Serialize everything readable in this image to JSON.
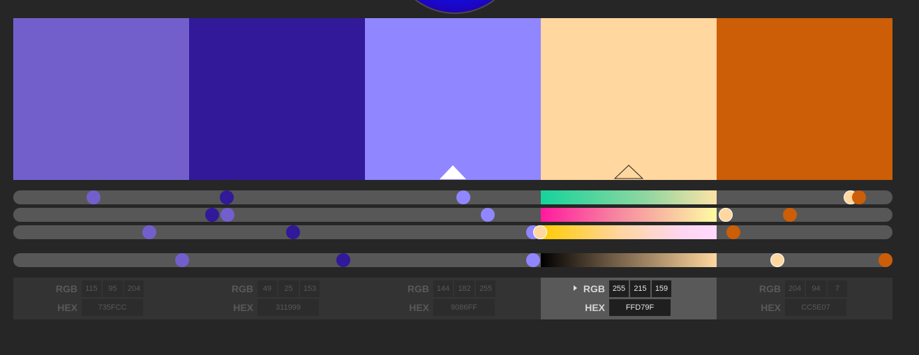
{
  "selected_index": 3,
  "swatches": [
    {
      "color": "#735FCC",
      "rgb": {
        "r": "115",
        "g": "95",
        "b": "204"
      },
      "hex": "735FCC",
      "values": {
        "h": 0.091,
        "s": 0.244,
        "b": 0.155,
        "v": 0.192
      }
    },
    {
      "color": "#311999",
      "rgb": {
        "r": "49",
        "g": "25",
        "b": "153"
      },
      "hex": "311999",
      "values": {
        "h": 0.243,
        "s": 0.226,
        "b": 0.318,
        "v": 0.375
      }
    },
    {
      "color": "#9086FF",
      "rgb": {
        "r": "144",
        "g": "182",
        "b": "255"
      },
      "hex": "9086FF",
      "values": {
        "h": 0.512,
        "s": 0.54,
        "b": 0.591,
        "v": 0.591
      }
    },
    {
      "color": "#FFD79F",
      "rgb": {
        "r": "255",
        "g": "215",
        "b": "159"
      },
      "hex": "FFD79F",
      "values": {
        "h": 0.952,
        "s": 0.81,
        "b": 0.599,
        "v": 0.869
      }
    },
    {
      "color": "#CC5E07",
      "rgb": {
        "r": "204",
        "g": "94",
        "b": "7"
      },
      "hex": "CC5E07",
      "values": {
        "h": 0.962,
        "s": 0.883,
        "b": 0.819,
        "v": 0.992
      }
    }
  ],
  "labels": {
    "rgb": "RGB",
    "hex": "HEX"
  }
}
